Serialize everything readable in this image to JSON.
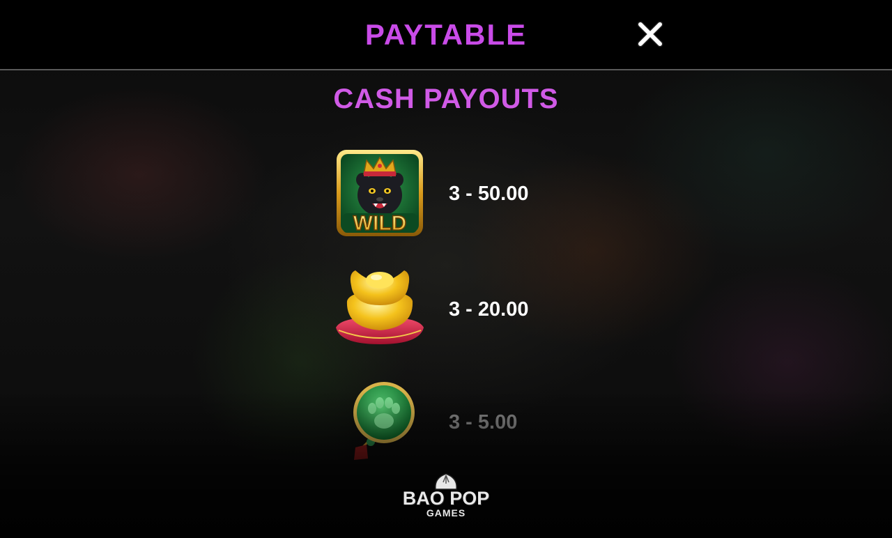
{
  "header": {
    "title": "PAYTABLE",
    "close_icon": "close-icon"
  },
  "section": {
    "title": "CASH PAYOUTS"
  },
  "payouts": [
    {
      "symbol": "wild-panther-icon",
      "symbol_label": "WILD",
      "payout": "3 - 50.00"
    },
    {
      "symbol": "gold-ingot-icon",
      "payout": "3 - 20.00"
    },
    {
      "symbol": "jade-paw-medallion-icon",
      "payout": "3 - 5.00"
    }
  ],
  "footer": {
    "logo_main": "BAO POP",
    "logo_sub": "GAMES"
  },
  "colors": {
    "title": "#c94be8",
    "section_title": "#d05ae6",
    "payout_text": "#ffffff",
    "dimmed_payout_text": "#8a8a8a",
    "header_bg": "#000000"
  }
}
